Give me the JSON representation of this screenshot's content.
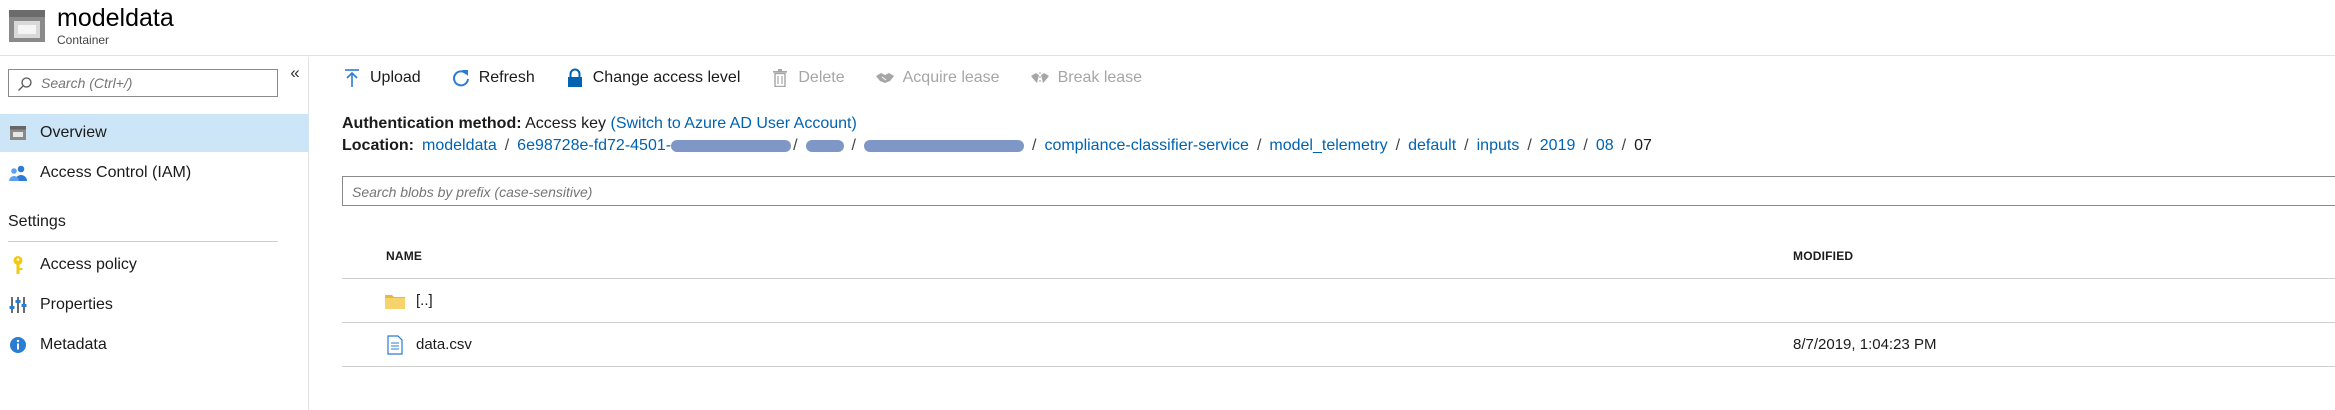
{
  "header": {
    "title": "modeldata",
    "subtitle": "Container",
    "icon": "storage-container-icon"
  },
  "sidebar": {
    "search_placeholder": "Search (Ctrl+/)",
    "collapse_glyph": "«",
    "items": [
      {
        "label": "Overview",
        "icon": "overview-icon",
        "active": true
      },
      {
        "label": "Access Control (IAM)",
        "icon": "iam-people-icon",
        "active": false
      }
    ],
    "settings_title": "Settings",
    "settings_items": [
      {
        "label": "Access policy",
        "icon": "key-icon"
      },
      {
        "label": "Properties",
        "icon": "properties-sliders-icon"
      },
      {
        "label": "Metadata",
        "icon": "info-icon"
      }
    ]
  },
  "toolbar": {
    "upload": "Upload",
    "refresh": "Refresh",
    "change_access": "Change access level",
    "delete": "Delete",
    "acquire_lease": "Acquire lease",
    "break_lease": "Break lease"
  },
  "auth": {
    "label": "Authentication method:",
    "value": "Access key",
    "link": "(Switch to Azure AD User Account)"
  },
  "location": {
    "label": "Location:",
    "segments": {
      "s0": "modeldata",
      "s1": "6e98728e-fd72-4501-",
      "s2": "compliance-classifier-service",
      "s3": "model_telemetry",
      "s4": "default",
      "s5": "inputs",
      "s6": "2019",
      "s7": "08",
      "s8": "07"
    },
    "separator": "/"
  },
  "blob_search": {
    "placeholder": "Search blobs by prefix (case-sensitive)"
  },
  "table": {
    "columns": {
      "name": "NAME",
      "modified": "MODIFIED"
    },
    "rows": [
      {
        "name": "[..]",
        "modified": "",
        "icon": "folder-icon"
      },
      {
        "name": "data.csv",
        "modified": "8/7/2019, 1:04:23 PM",
        "icon": "file-icon"
      }
    ]
  },
  "colors": {
    "accent": "#0063b1",
    "active_nav": "#cde6f7",
    "disabled_text": "#a6a6a6"
  }
}
